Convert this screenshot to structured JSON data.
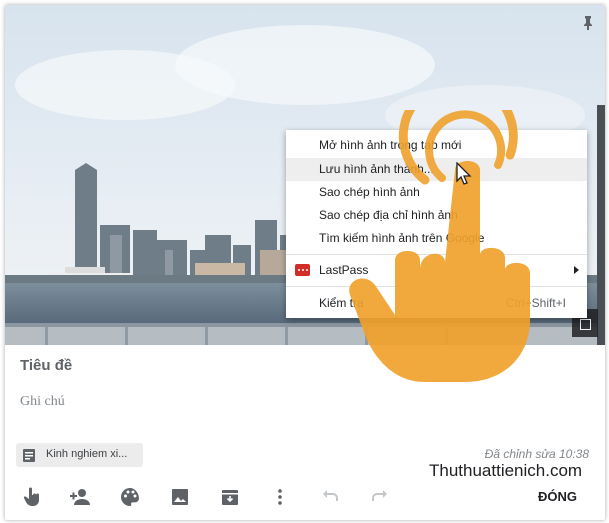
{
  "note_card": {
    "title_placeholder": "Tiêu đề",
    "note_placeholder": "Ghi chú",
    "edited_text": "Đã chỉnh sửa 10:38",
    "label_chip": "Kinh nghiem xi...",
    "close_button": "ĐÓNG"
  },
  "context_menu": {
    "items": [
      {
        "label": "Mở hình ảnh trong tab mới"
      },
      {
        "label": "Lưu hình ảnh thành..."
      },
      {
        "label": "Sao chép hình ảnh"
      },
      {
        "label": "Sao chép địa chỉ hình ảnh"
      },
      {
        "label": "Tìm kiếm hình ảnh trên Google"
      },
      {
        "label": "LastPass"
      },
      {
        "label": "Kiểm tra",
        "shortcut": "Ctrl+Shift+I"
      }
    ]
  },
  "watermark": "Thuthuattienich.com",
  "toolbar_icons": [
    "hand-pointer-icon",
    "add-person-icon",
    "palette-icon",
    "image-icon",
    "archive-icon",
    "more-vert-icon",
    "undo-icon",
    "redo-icon"
  ],
  "colors": {
    "hand": "#f0a12d",
    "lastpass": "#d32d27",
    "menu_highlight": "#eeeeee"
  }
}
